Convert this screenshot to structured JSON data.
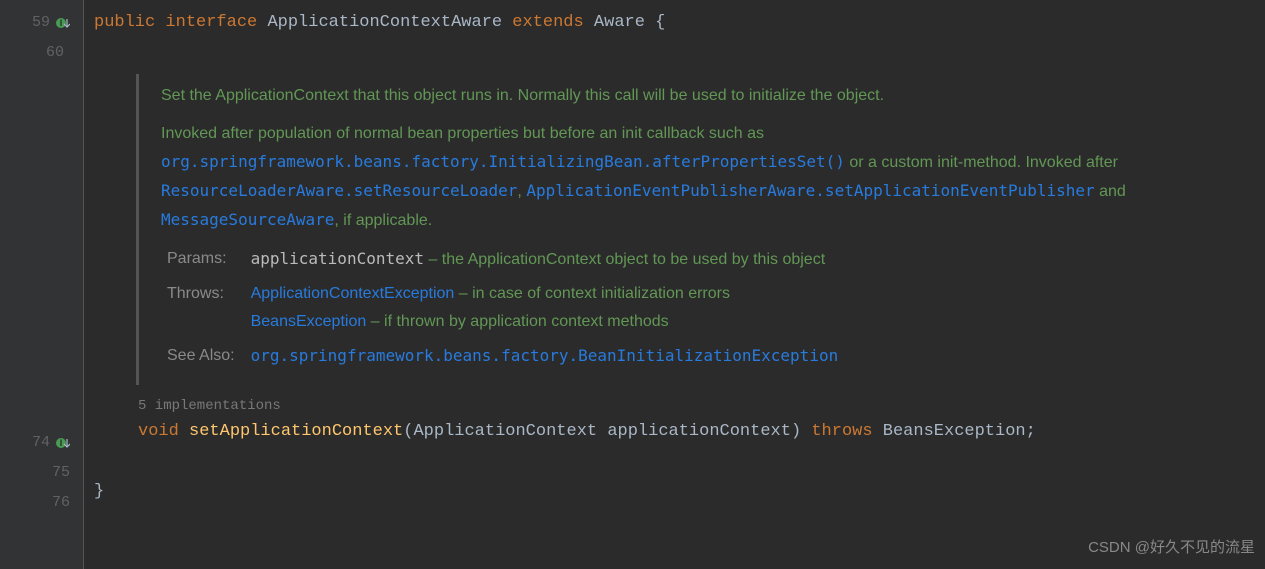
{
  "gutter": {
    "l59": "59",
    "l60": "60",
    "l74": "74",
    "l75": "75",
    "l76": "76"
  },
  "line59": {
    "kw_public": "public",
    "kw_interface": "interface",
    "type": "ApplicationContextAware",
    "kw_extends": "extends",
    "super": "Aware",
    "brace": "{"
  },
  "doc": {
    "p1": "Set the ApplicationContext that this object runs in. Normally this call will be used to initialize the object.",
    "p2_a": "Invoked after population of normal bean properties but before an init callback such as ",
    "p2_code1": "org.springframework.beans.factory.InitializingBean.afterPropertiesSet()",
    "p2_b": " or a custom init-method. Invoked after ",
    "p2_code2": "ResourceLoaderAware.setResourceLoader",
    "p2_c": ", ",
    "p2_code3": "ApplicationEventPublisherAware.setApplicationEventPublisher",
    "p2_d": " and ",
    "p2_code4": "MessageSourceAware",
    "p2_e": ", if applicable.",
    "params_lbl": "Params:",
    "params_name": "applicationContext",
    "params_desc": " – the ApplicationContext object to be used by this object",
    "throws_lbl": "Throws:",
    "throws1_name": "ApplicationContextException",
    "throws1_desc": " – in case of context initialization errors",
    "throws2_name": "BeansException",
    "throws2_desc": " – if thrown by application context methods",
    "see_lbl": "See Also:",
    "see_ref": "org.springframework.beans.factory.BeanInitializationException"
  },
  "hint": "5 implementations",
  "sig": {
    "kw_void": "void",
    "method": "setApplicationContext",
    "lp": "(",
    "ptype": "ApplicationContext",
    "sp": " ",
    "pname": "applicationContext",
    "rp": ")",
    "kw_throws": "throws",
    "ex": "BeansException",
    "semi": ";"
  },
  "closebrace": "}",
  "watermark": "CSDN @好久不见的流星"
}
